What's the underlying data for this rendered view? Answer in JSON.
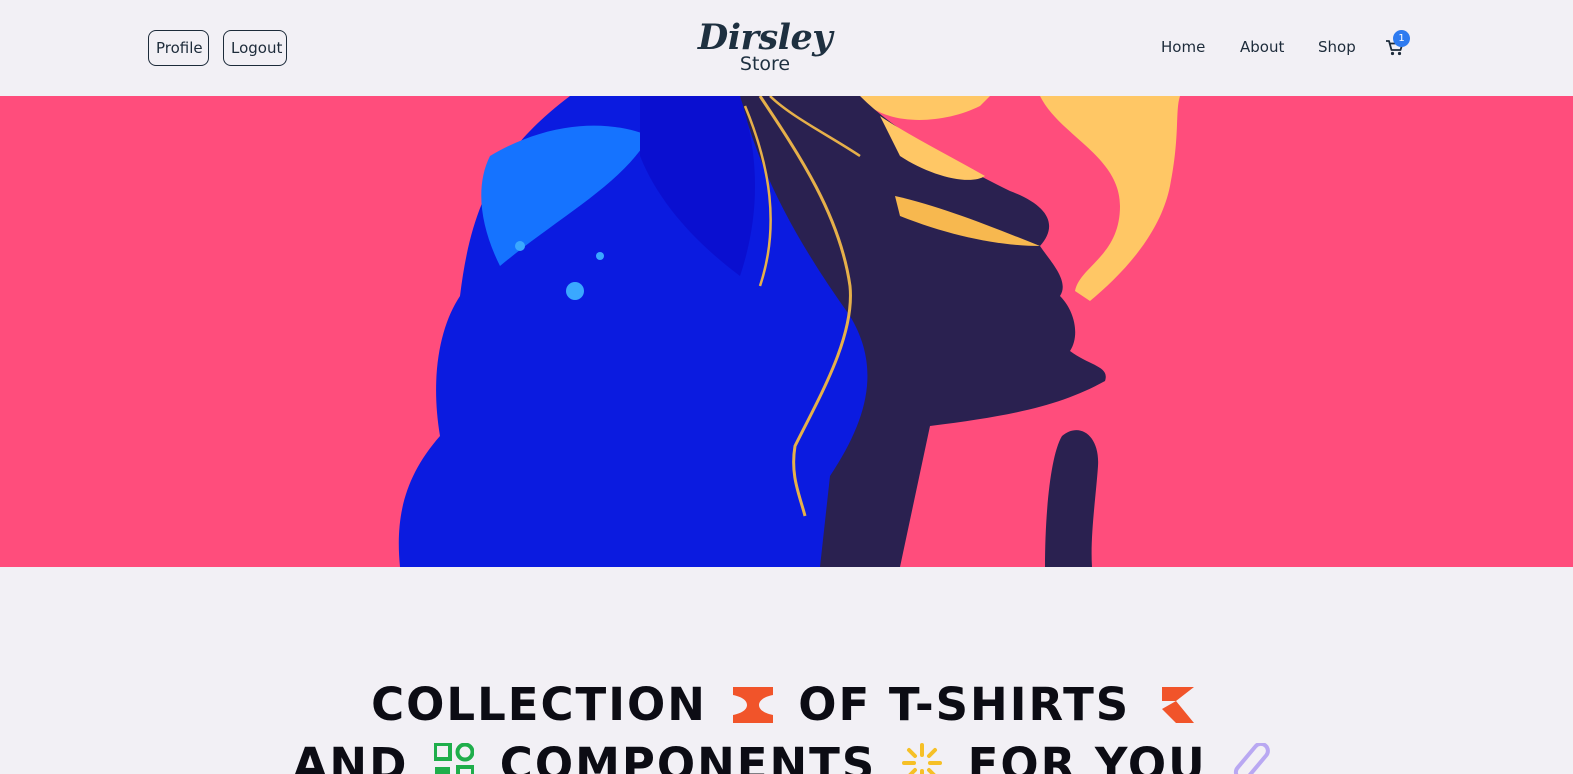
{
  "header": {
    "profile_label": "Profile",
    "logout_label": "Logout",
    "logo_main": "Dirsley",
    "logo_sub": "Store",
    "nav": {
      "home": "Home",
      "about": "About",
      "shop": "Shop"
    },
    "cart_icon": "cart-icon",
    "cart_count": "1"
  },
  "hero": {
    "image": "illustration of a woman with blue hair exhaling yellow smoke"
  },
  "headline": {
    "line1_a": "COLLECTION",
    "line1_b": "OF T-SHIRTS",
    "line2_a": "AND",
    "line2_b": "COMPONENTS",
    "line2_c": "FOR YOU"
  },
  "colors": {
    "background": "#f2f0f5",
    "hero": "#ff4d7c",
    "badge": "#2e7bf0",
    "accent_orange": "#f1542a",
    "accent_green": "#1fae4b",
    "accent_yellow": "#f6c026",
    "accent_lilac": "#b9a8f2"
  }
}
